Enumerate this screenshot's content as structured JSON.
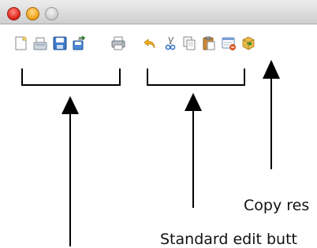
{
  "window": {
    "traffic_lights": [
      {
        "name": "close",
        "color": "#e0251b"
      },
      {
        "name": "minimize",
        "color": "#f0a51b"
      },
      {
        "name": "zoom",
        "color": "#c9c9c9"
      }
    ]
  },
  "toolbar": {
    "groups": [
      {
        "name": "file",
        "icons": [
          "new-document-icon",
          "open-document-icon",
          "save-icon",
          "save-as-icon",
          "print-icon"
        ]
      },
      {
        "name": "edit",
        "icons": [
          "undo-icon",
          "cut-icon",
          "copy-icon",
          "paste-icon",
          "delete-icon"
        ]
      },
      {
        "name": "resources",
        "icons": [
          "copy-resources-icon"
        ]
      }
    ]
  },
  "callouts": {
    "copy_resources": "Copy res",
    "standard_edit": "Standard edit butt"
  }
}
